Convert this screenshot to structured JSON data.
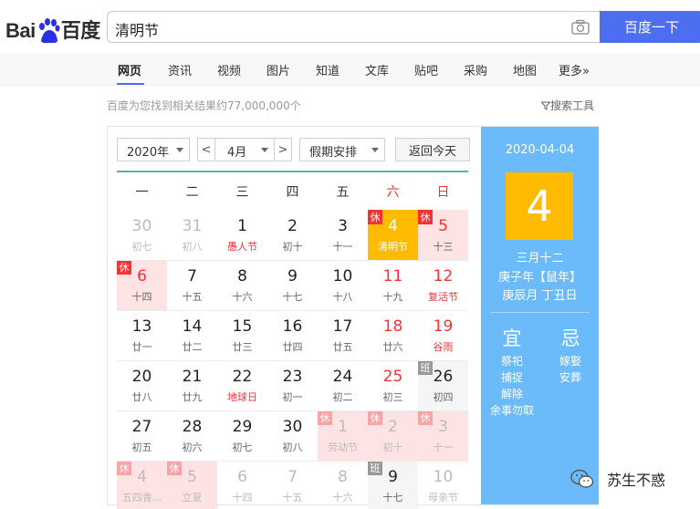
{
  "header": {
    "logo_text_left": "Bai",
    "logo_text_mid": "du",
    "logo_text_right": "百度",
    "query": "清明节",
    "search_button": "百度一下"
  },
  "nav": [
    "网页",
    "资讯",
    "视频",
    "图片",
    "知道",
    "文库",
    "贴吧",
    "采购",
    "地图",
    "更多»"
  ],
  "result_info": "百度为您找到相关结果约77,000,000个",
  "search_tools": "搜索工具",
  "calendar": {
    "year_select": "2020年",
    "prev": "<",
    "month_select": "4月",
    "next": ">",
    "holiday_select": "假期安排",
    "today_button": "返回今天",
    "weekdays": [
      "一",
      "二",
      "三",
      "四",
      "五",
      "六",
      "日"
    ],
    "rest_badge": "休",
    "work_badge": "班",
    "weeks": [
      [
        {
          "d": "30",
          "l": "初七",
          "other": true
        },
        {
          "d": "31",
          "l": "初八",
          "other": true
        },
        {
          "d": "1",
          "l": "愚人节",
          "festival": true
        },
        {
          "d": "2",
          "l": "初十"
        },
        {
          "d": "3",
          "l": "十一"
        },
        {
          "d": "4",
          "l": "清明节",
          "selected": true,
          "holiday": true,
          "weekend": true
        },
        {
          "d": "5",
          "l": "十三",
          "holiday": true,
          "weekend": true
        }
      ],
      [
        {
          "d": "6",
          "l": "十四",
          "holiday": true,
          "weekend": true
        },
        {
          "d": "7",
          "l": "十五"
        },
        {
          "d": "8",
          "l": "十六"
        },
        {
          "d": "9",
          "l": "十七"
        },
        {
          "d": "10",
          "l": "十八"
        },
        {
          "d": "11",
          "l": "十九",
          "weekend": true
        },
        {
          "d": "12",
          "l": "复活节",
          "weekend": true,
          "festival": true
        }
      ],
      [
        {
          "d": "13",
          "l": "廿一"
        },
        {
          "d": "14",
          "l": "廿二"
        },
        {
          "d": "15",
          "l": "廿三"
        },
        {
          "d": "16",
          "l": "廿四"
        },
        {
          "d": "17",
          "l": "廿五"
        },
        {
          "d": "18",
          "l": "廿六",
          "weekend": true
        },
        {
          "d": "19",
          "l": "谷雨",
          "weekend": true,
          "festival": true
        }
      ],
      [
        {
          "d": "20",
          "l": "廿八"
        },
        {
          "d": "21",
          "l": "廿九"
        },
        {
          "d": "22",
          "l": "地球日",
          "festival": true
        },
        {
          "d": "23",
          "l": "初一"
        },
        {
          "d": "24",
          "l": "初二"
        },
        {
          "d": "25",
          "l": "初三",
          "weekend": true
        },
        {
          "d": "26",
          "l": "初四",
          "workday": true
        }
      ],
      [
        {
          "d": "27",
          "l": "初五"
        },
        {
          "d": "28",
          "l": "初六"
        },
        {
          "d": "29",
          "l": "初七"
        },
        {
          "d": "30",
          "l": "初八"
        },
        {
          "d": "1",
          "l": "劳动节",
          "other": true,
          "holiday": true
        },
        {
          "d": "2",
          "l": "初十",
          "other": true,
          "holiday": true
        },
        {
          "d": "3",
          "l": "十一",
          "other": true,
          "holiday": true
        }
      ],
      [
        {
          "d": "4",
          "l": "五四青...",
          "other": true,
          "holiday": true
        },
        {
          "d": "5",
          "l": "立夏",
          "other": true,
          "holiday": true
        },
        {
          "d": "6",
          "l": "十四",
          "other": true
        },
        {
          "d": "7",
          "l": "十五",
          "other": true
        },
        {
          "d": "8",
          "l": "十六",
          "other": true
        },
        {
          "d": "9",
          "l": "十七",
          "workday": true
        },
        {
          "d": "10",
          "l": "母亲节",
          "other": true
        }
      ]
    ],
    "side": {
      "date": "2020-04-04",
      "day": "4",
      "lunar": "三月十二",
      "year_line": "庚子年【鼠年】",
      "month_line": "庚辰月 丁丑日",
      "yi_title": "宜",
      "ji_title": "忌",
      "yi": [
        "祭祀",
        "捕捉",
        "解除",
        "余事勿取"
      ],
      "ji": [
        "嫁娶",
        "安葬"
      ]
    }
  },
  "watermark": "苏生不惑",
  "colors": {
    "accent": "#4e6ef2",
    "selected": "#ffbb00",
    "side_panel": "#6bbafa",
    "holiday_bg": "#fde3e4",
    "red": "#f73131"
  }
}
